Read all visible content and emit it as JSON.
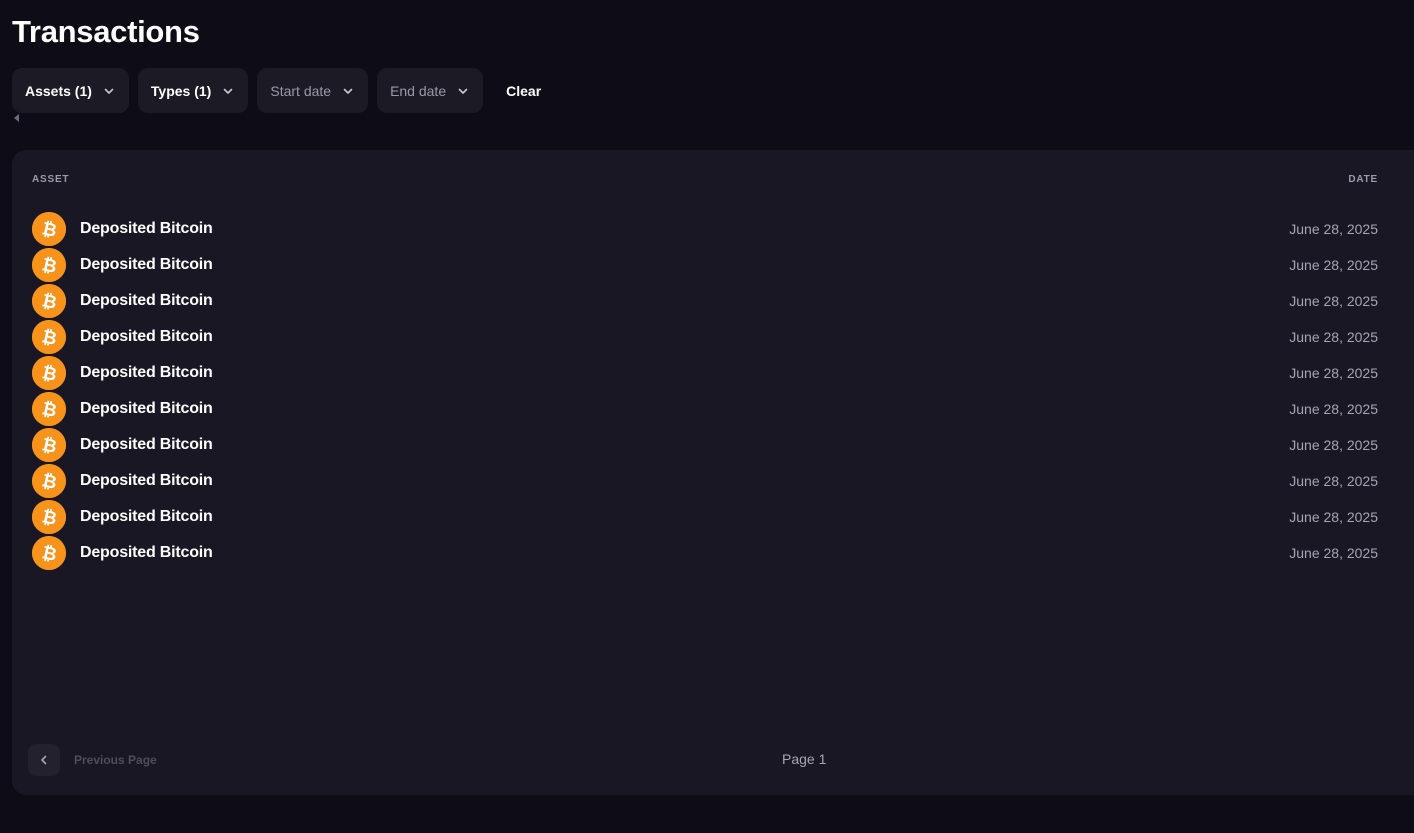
{
  "header": {
    "title": "Transactions"
  },
  "filters": {
    "assets": {
      "label": "Assets (1)"
    },
    "types": {
      "label": "Types (1)"
    },
    "start_date": {
      "label": "Start date"
    },
    "end_date": {
      "label": "End date"
    },
    "clear": {
      "label": "Clear"
    }
  },
  "table": {
    "columns": {
      "asset": "ASSET",
      "date": "DATE"
    },
    "rows": [
      {
        "icon": "bitcoin-icon",
        "title": "Deposited Bitcoin",
        "date": "June 28, 2025"
      },
      {
        "icon": "bitcoin-icon",
        "title": "Deposited Bitcoin",
        "date": "June 28, 2025"
      },
      {
        "icon": "bitcoin-icon",
        "title": "Deposited Bitcoin",
        "date": "June 28, 2025"
      },
      {
        "icon": "bitcoin-icon",
        "title": "Deposited Bitcoin",
        "date": "June 28, 2025"
      },
      {
        "icon": "bitcoin-icon",
        "title": "Deposited Bitcoin",
        "date": "June 28, 2025"
      },
      {
        "icon": "bitcoin-icon",
        "title": "Deposited Bitcoin",
        "date": "June 28, 2025"
      },
      {
        "icon": "bitcoin-icon",
        "title": "Deposited Bitcoin",
        "date": "June 28, 2025"
      },
      {
        "icon": "bitcoin-icon",
        "title": "Deposited Bitcoin",
        "date": "June 28, 2025"
      },
      {
        "icon": "bitcoin-icon",
        "title": "Deposited Bitcoin",
        "date": "June 28, 2025"
      },
      {
        "icon": "bitcoin-icon",
        "title": "Deposited Bitcoin",
        "date": "June 28, 2025"
      }
    ]
  },
  "pagination": {
    "previous_label": "Previous Page",
    "page_label": "Page 1"
  },
  "colors": {
    "background": "#0e0d15",
    "card": "#181723",
    "bitcoin": "#f7931a"
  }
}
